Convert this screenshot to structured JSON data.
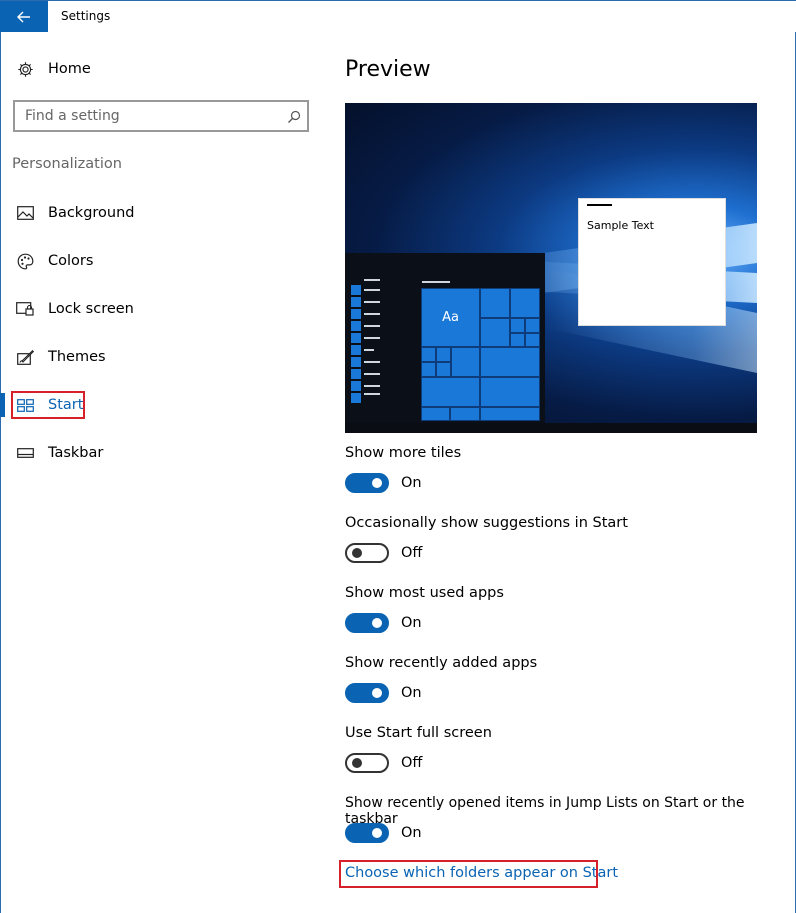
{
  "window": {
    "title": "Settings"
  },
  "sidebar": {
    "home_label": "Home",
    "search_placeholder": "Find a setting",
    "section_label": "Personalization",
    "items": [
      {
        "label": "Background",
        "icon": "picture-icon"
      },
      {
        "label": "Colors",
        "icon": "palette-icon"
      },
      {
        "label": "Lock screen",
        "icon": "lock-screen-icon"
      },
      {
        "label": "Themes",
        "icon": "themes-brush-icon"
      },
      {
        "label": "Start",
        "icon": "start-tiles-icon",
        "selected": true
      },
      {
        "label": "Taskbar",
        "icon": "taskbar-icon"
      }
    ]
  },
  "main": {
    "preview_title": "Preview",
    "preview": {
      "sample_text": "Sample Text",
      "tile_text": "Aa"
    },
    "settings": [
      {
        "label": "Show more tiles",
        "state": "On"
      },
      {
        "label": "Occasionally show suggestions in Start",
        "state": "Off"
      },
      {
        "label": "Show most used apps",
        "state": "On"
      },
      {
        "label": "Show recently added apps",
        "state": "On"
      },
      {
        "label": "Use Start full screen",
        "state": "Off"
      },
      {
        "label": "Show recently opened items in Jump Lists on Start or the taskbar",
        "state": "On"
      }
    ],
    "folders_link": "Choose which folders appear on Start"
  },
  "colors": {
    "accent": "#0a64b3",
    "highlight_box": "#d6202a"
  }
}
